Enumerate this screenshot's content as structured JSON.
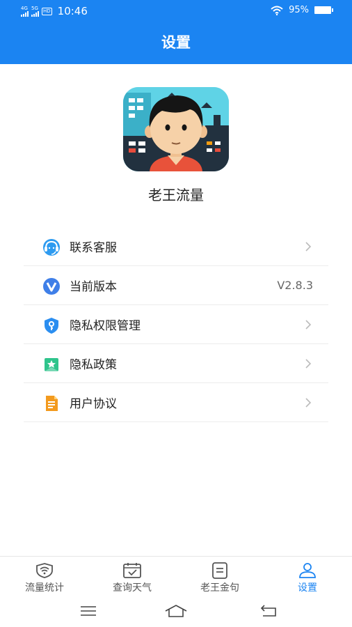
{
  "status_bar": {
    "network1": "4G",
    "network2": "5G",
    "hd": "HD",
    "time": "10:46",
    "battery": "95%"
  },
  "header": {
    "title": "设置"
  },
  "app": {
    "name": "老王流量"
  },
  "menu": {
    "items": [
      {
        "label": "联系客服",
        "icon": "customer-service-icon"
      },
      {
        "label": "当前版本",
        "icon": "version-icon",
        "value": "V2.8.3"
      },
      {
        "label": "隐私权限管理",
        "icon": "privacy-shield-icon"
      },
      {
        "label": "隐私政策",
        "icon": "bookmark-star-icon"
      },
      {
        "label": "用户协议",
        "icon": "document-icon"
      }
    ]
  },
  "bottom_nav": {
    "items": [
      {
        "label": "流量统计",
        "icon": "wifi-shield-icon"
      },
      {
        "label": "查询天气",
        "icon": "calendar-check-icon"
      },
      {
        "label": "老王金句",
        "icon": "note-icon"
      },
      {
        "label": "设置",
        "icon": "user-icon",
        "active": true
      }
    ]
  },
  "colors": {
    "primary": "#1b84f2",
    "text": "#222222",
    "muted": "#666666"
  }
}
